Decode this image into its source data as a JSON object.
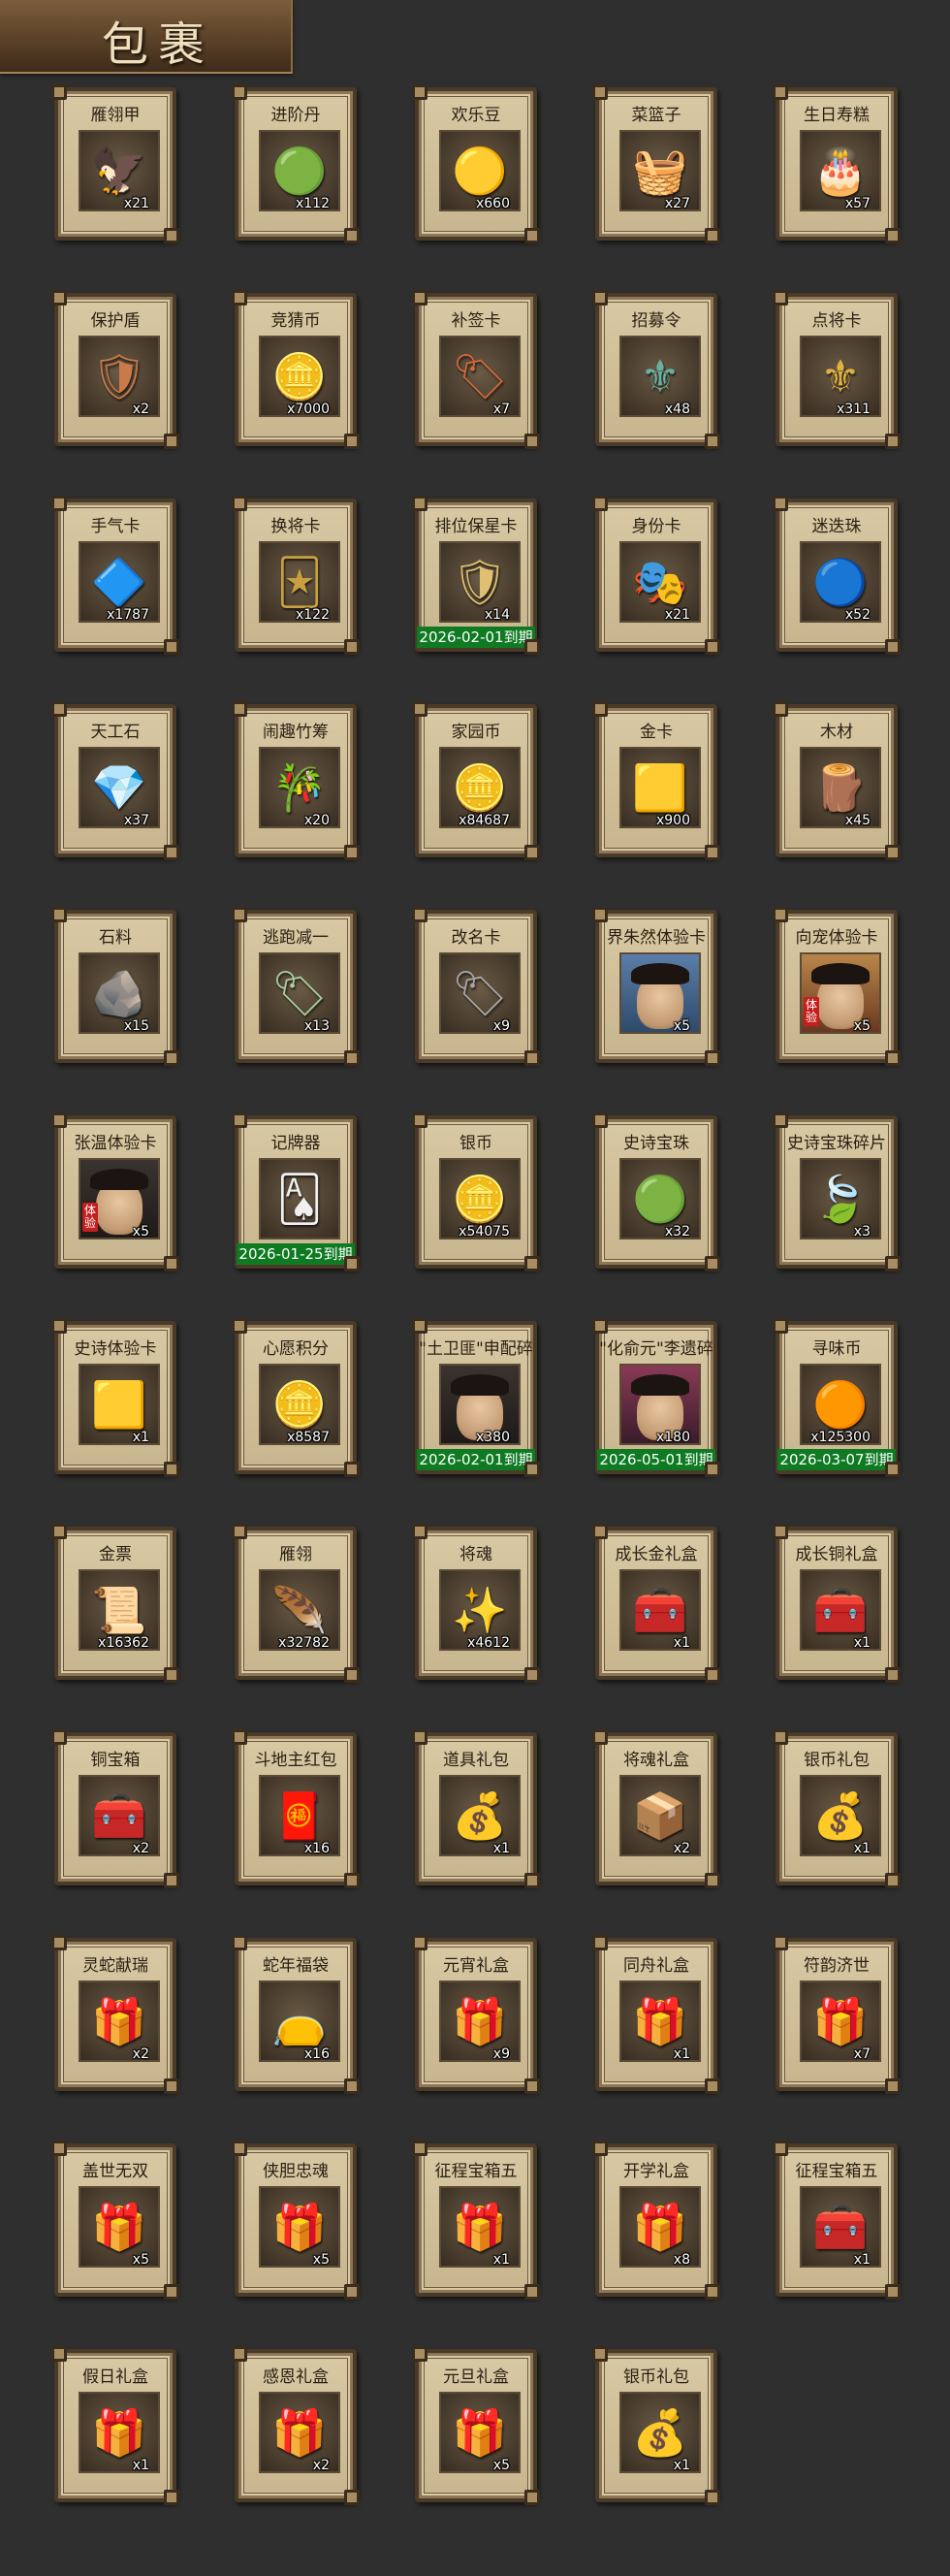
{
  "header": {
    "title": "包裹"
  },
  "colors": {
    "background": "#2f2f2f",
    "card": "#d8c9a4",
    "expiry_banner": "#0e7a22",
    "quantity_text": "#ffffff"
  },
  "items": [
    {
      "name": "雁翎甲",
      "qty": "x21",
      "icon": "armor-icon",
      "glyph": "🦅",
      "color": "#c24a2a"
    },
    {
      "name": "进阶丹",
      "qty": "x112",
      "icon": "pill-icon",
      "glyph": "🟢",
      "color": "#6adc5a"
    },
    {
      "name": "欢乐豆",
      "qty": "x660",
      "icon": "beans-icon",
      "glyph": "🟡",
      "color": "#f4c430"
    },
    {
      "name": "菜篮子",
      "qty": "x27",
      "icon": "basket-icon",
      "glyph": "🧺",
      "color": "#d86a3a"
    },
    {
      "name": "生日寿糕",
      "qty": "x57",
      "icon": "cake-icon",
      "glyph": "🎂",
      "color": "#f5a623"
    },
    {
      "name": "保护盾",
      "qty": "x2",
      "icon": "shield-icon",
      "glyph": "🛡",
      "color": "#c87a4a"
    },
    {
      "name": "竞猜币",
      "qty": "x7000",
      "icon": "coin-icon",
      "glyph": "🪙",
      "color": "#b8bec8"
    },
    {
      "name": "补签卡",
      "qty": "x7",
      "icon": "card-icon",
      "glyph": "🏷",
      "color": "#d06a3a"
    },
    {
      "name": "招募令",
      "qty": "x48",
      "icon": "token-icon",
      "glyph": "⚜",
      "color": "#6ab0a0"
    },
    {
      "name": "点将卡",
      "qty": "x311",
      "icon": "general-card-icon",
      "glyph": "⚜",
      "color": "#e0b040"
    },
    {
      "name": "手气卡",
      "qty": "x1787",
      "icon": "luck-card-icon",
      "glyph": "🔷",
      "color": "#f0b030"
    },
    {
      "name": "换将卡",
      "qty": "x122",
      "icon": "swap-card-icon",
      "glyph": "🃏",
      "color": "#c8a040"
    },
    {
      "name": "排位保星卡",
      "qty": "x14",
      "icon": "rank-card-icon",
      "glyph": "🛡",
      "color": "#e0c070",
      "expiry": "2026-02-01到期"
    },
    {
      "name": "身份卡",
      "qty": "x21",
      "icon": "identity-card-icon",
      "glyph": "🎭",
      "color": "#e8e0d0"
    },
    {
      "name": "迷迭珠",
      "qty": "x52",
      "icon": "orb-icon",
      "glyph": "🔵",
      "color": "#5aa8f0"
    },
    {
      "name": "天工石",
      "qty": "x37",
      "icon": "crystal-icon",
      "glyph": "💎",
      "color": "#4ab0e8"
    },
    {
      "name": "闹趣竹筹",
      "qty": "x20",
      "icon": "bamboo-icon",
      "glyph": "🎋",
      "color": "#d8b070"
    },
    {
      "name": "家园币",
      "qty": "x84687",
      "icon": "home-coin-icon",
      "glyph": "🪙",
      "color": "#c8b890"
    },
    {
      "name": "金卡",
      "qty": "x900",
      "icon": "gold-card-icon",
      "glyph": "🟨",
      "color": "#e8b030"
    },
    {
      "name": "木材",
      "qty": "x45",
      "icon": "wood-icon",
      "glyph": "🪵",
      "color": "#a85a3a"
    },
    {
      "name": "石料",
      "qty": "x15",
      "icon": "stone-icon",
      "glyph": "🪨",
      "color": "#c8b8a0"
    },
    {
      "name": "逃跑减一",
      "qty": "x13",
      "icon": "escape-tag-icon",
      "glyph": "🏷",
      "color": "#a8d0a0"
    },
    {
      "name": "改名卡",
      "qty": "x9",
      "icon": "rename-card-icon",
      "glyph": "🏷",
      "color": "#a8a8a8"
    },
    {
      "name": "界朱然体验卡",
      "qty": "x5",
      "icon": "portrait-icon",
      "portrait": "blue"
    },
    {
      "name": "向宠体验卡",
      "qty": "x5",
      "icon": "portrait-icon",
      "portrait": "red",
      "badge": "体验"
    },
    {
      "name": "张温体验卡",
      "qty": "x5",
      "icon": "portrait-icon",
      "portrait": "dark",
      "badge": "体验"
    },
    {
      "name": "记牌器",
      "qty": "",
      "icon": "card-counter-icon",
      "glyph": "🂡",
      "color": "#f0f0f0",
      "expiry": "2026-01-25到期"
    },
    {
      "name": "银币",
      "qty": "x54075",
      "icon": "silver-coin-icon",
      "glyph": "🪙",
      "color": "#a8c8d0"
    },
    {
      "name": "史诗宝珠",
      "qty": "x32",
      "icon": "epic-orb-icon",
      "glyph": "🟢",
      "color": "#3ad04a"
    },
    {
      "name": "史诗宝珠碎片",
      "qty": "x3",
      "icon": "orb-fragment-icon",
      "glyph": "🍃",
      "color": "#5ad04a"
    },
    {
      "name": "史诗体验卡",
      "qty": "x1",
      "icon": "epic-card-icon",
      "glyph": "🟨",
      "color": "#f0d050"
    },
    {
      "name": "心愿积分",
      "qty": "x8587",
      "icon": "wish-coin-icon",
      "glyph": "🪙",
      "color": "#d8b890"
    },
    {
      "name": "\"土卫匪\"申配碎",
      "qty": "x380",
      "icon": "portrait-icon",
      "portrait": "dark",
      "expiry": "2026-02-01到期"
    },
    {
      "name": "\"化俞元\"李遗碎",
      "qty": "x180",
      "icon": "portrait-icon",
      "portrait": "purple",
      "expiry": "2026-05-01到期"
    },
    {
      "name": "寻味币",
      "qty": "x125300",
      "icon": "taste-coin-icon",
      "glyph": "🟠",
      "color": "#d8502a",
      "expiry": "2026-03-07到期"
    },
    {
      "name": "金票",
      "qty": "x16362",
      "icon": "gold-ticket-icon",
      "glyph": "📜",
      "color": "#f0c040"
    },
    {
      "name": "雁翎",
      "qty": "x32782",
      "icon": "feather-icon",
      "glyph": "🪶",
      "color": "#d86a3a"
    },
    {
      "name": "将魂",
      "qty": "x4612",
      "icon": "soul-icon",
      "glyph": "✨",
      "color": "#5ad04a"
    },
    {
      "name": "成长金礼盒",
      "qty": "x1",
      "icon": "gold-chest-icon",
      "glyph": "🧰",
      "color": "#e0a030"
    },
    {
      "name": "成长铜礼盒",
      "qty": "x1",
      "icon": "bronze-chest-icon",
      "glyph": "🧰",
      "color": "#a85a3a"
    },
    {
      "name": "铜宝箱",
      "qty": "x2",
      "icon": "copper-chest-icon",
      "glyph": "🧰",
      "color": "#3a8a5a"
    },
    {
      "name": "斗地主红包",
      "qty": "x16",
      "icon": "red-envelope-icon",
      "glyph": "🧧",
      "color": "#e02020"
    },
    {
      "name": "道具礼包",
      "qty": "x1",
      "icon": "item-bag-icon",
      "glyph": "💰",
      "color": "#f0c020"
    },
    {
      "name": "将魂礼盒",
      "qty": "x2",
      "icon": "soul-box-icon",
      "glyph": "📦",
      "color": "#3a3ab0"
    },
    {
      "name": "银币礼包",
      "qty": "x1",
      "icon": "silver-bag-icon",
      "glyph": "💰",
      "color": "#3a7ae0"
    },
    {
      "name": "灵蛇献瑞",
      "qty": "x2",
      "icon": "gift-box-icon",
      "glyph": "🎁",
      "color": "#d83030"
    },
    {
      "name": "蛇年福袋",
      "qty": "x16",
      "icon": "lucky-bag-icon",
      "glyph": "👝",
      "color": "#c82a2a"
    },
    {
      "name": "元宵礼盒",
      "qty": "x9",
      "icon": "gift-box-icon",
      "glyph": "🎁",
      "color": "#b03a8a"
    },
    {
      "name": "同舟礼盒",
      "qty": "x1",
      "icon": "gift-box-icon",
      "glyph": "🎁",
      "color": "#3a7ab0"
    },
    {
      "name": "符韵济世",
      "qty": "x7",
      "icon": "gift-box-icon",
      "glyph": "🎁",
      "color": "#e0a030"
    },
    {
      "name": "盖世无双",
      "qty": "x5",
      "icon": "gift-box-icon",
      "glyph": "🎁",
      "color": "#d83030"
    },
    {
      "name": "侠胆忠魂",
      "qty": "x5",
      "icon": "gift-box-icon",
      "glyph": "🎁",
      "color": "#e0a030"
    },
    {
      "name": "征程宝箱五",
      "qty": "x1",
      "icon": "ribbon-box-icon",
      "glyph": "🎁",
      "color": "#6ab0e0"
    },
    {
      "name": "开学礼盒",
      "qty": "x8",
      "icon": "gift-box-icon",
      "glyph": "🎁",
      "color": "#c83a8a"
    },
    {
      "name": "征程宝箱五",
      "qty": "x1",
      "icon": "treasure-chest-icon",
      "glyph": "🧰",
      "color": "#d83030"
    },
    {
      "name": "假日礼盒",
      "qty": "x1",
      "icon": "gift-box-icon",
      "glyph": "🎁",
      "color": "#d83030"
    },
    {
      "name": "感恩礼盒",
      "qty": "x2",
      "icon": "gift-box-icon",
      "glyph": "🎁",
      "color": "#3a7ab0"
    },
    {
      "name": "元旦礼盒",
      "qty": "x5",
      "icon": "gift-box-icon",
      "glyph": "🎁",
      "color": "#d83030"
    },
    {
      "name": "银币礼包",
      "qty": "x1",
      "icon": "silver-bag-icon",
      "glyph": "💰",
      "color": "#3a7ae0"
    }
  ]
}
